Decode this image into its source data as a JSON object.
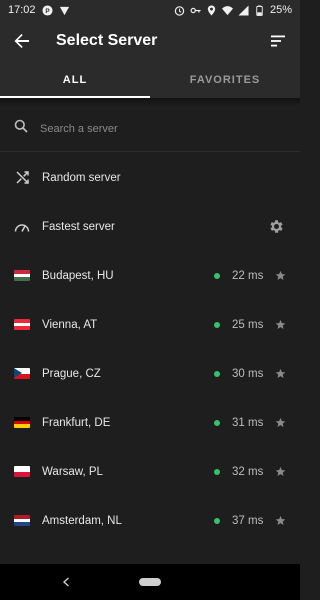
{
  "status_bar": {
    "time": "17:02",
    "battery": "25%"
  },
  "app_bar": {
    "title": "Select Server"
  },
  "tabs": [
    {
      "label": "ALL",
      "active": true
    },
    {
      "label": "FAVORITES",
      "active": false
    }
  ],
  "search": {
    "placeholder": "Search a server",
    "value": ""
  },
  "special": {
    "random_label": "Random server",
    "fastest_label": "Fastest server"
  },
  "servers": [
    {
      "name": "Budapest, HU",
      "ping": "22 ms",
      "flag": [
        "#cd2a3e",
        "#ffffff",
        "#436f4d"
      ]
    },
    {
      "name": "Vienna, AT",
      "ping": "25 ms",
      "flag": [
        "#ed2939",
        "#ffffff",
        "#ed2939"
      ]
    },
    {
      "name": "Prague, CZ",
      "ping": "30 ms",
      "flag": [
        "#ffffff",
        "#d7141a",
        "#11457e"
      ]
    },
    {
      "name": "Frankfurt, DE",
      "ping": "31 ms",
      "flag": [
        "#000000",
        "#dd0000",
        "#ffce00"
      ]
    },
    {
      "name": "Warsaw, PL",
      "ping": "32 ms",
      "flag": [
        "#ffffff",
        "#dc143c"
      ]
    },
    {
      "name": "Amsterdam, NL",
      "ping": "37 ms",
      "flag": [
        "#ae1c28",
        "#ffffff",
        "#21468b"
      ]
    }
  ],
  "colors": {
    "accent": "#ffffff",
    "ping_good": "#34c26b",
    "background": "#1e1e1e",
    "bar": "#2b2b2b"
  }
}
